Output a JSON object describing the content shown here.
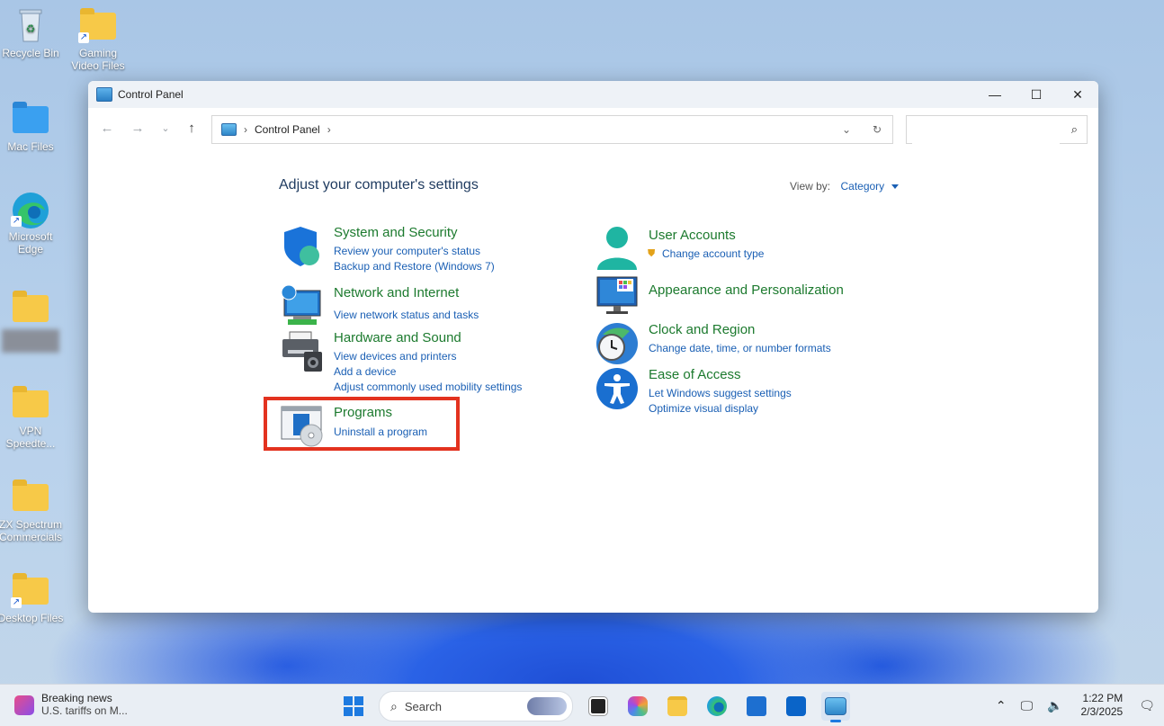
{
  "desktop": {
    "icons": [
      {
        "label": "Recycle Bin"
      },
      {
        "label": "Gaming Video Files"
      },
      {
        "label": "Mac Files"
      },
      {
        "label": "Microsoft Edge"
      },
      {
        "label": "VPN Speedte..."
      },
      {
        "label": "ZX Spectrum Commercials"
      },
      {
        "label": "Desktop Files"
      }
    ]
  },
  "window": {
    "title": "Control Panel",
    "controls": {
      "minimize": "—",
      "maximize": "☐",
      "close": "✕"
    },
    "address": {
      "crumb": "Control Panel"
    },
    "search": {
      "placeholder": ""
    }
  },
  "control_panel": {
    "heading": "Adjust your computer's settings",
    "view_by_label": "View by:",
    "view_by_value": "Category",
    "categories": [
      {
        "title": "System and Security",
        "links": [
          "Review your computer's status",
          "Backup and Restore (Windows 7)"
        ],
        "icon": "shield-icon"
      },
      {
        "title": "Network and Internet",
        "links": [
          "View network status and tasks"
        ],
        "icon": "network-icon"
      },
      {
        "title": "Hardware and Sound",
        "links": [
          "View devices and printers",
          "Add a device",
          "Adjust commonly used mobility settings"
        ],
        "icon": "printer-icon"
      },
      {
        "title": "Programs",
        "links": [
          "Uninstall a program"
        ],
        "icon": "programs-icon"
      },
      {
        "title": "User Accounts",
        "links": [
          "Change account type"
        ],
        "icon": "user-icon"
      },
      {
        "title": "Appearance and Personalization",
        "links": [],
        "icon": "monitor-icon"
      },
      {
        "title": "Clock and Region",
        "links": [
          "Change date, time, or number formats"
        ],
        "icon": "clock-globe-icon"
      },
      {
        "title": "Ease of Access",
        "links": [
          "Let Windows suggest settings",
          "Optimize visual display"
        ],
        "icon": "accessibility-icon"
      }
    ]
  },
  "taskbar": {
    "news_title": "Breaking news",
    "news_sub": "U.S. tariffs on M...",
    "search_label": "Search",
    "time": "1:22 PM",
    "date": "2/3/2025"
  }
}
